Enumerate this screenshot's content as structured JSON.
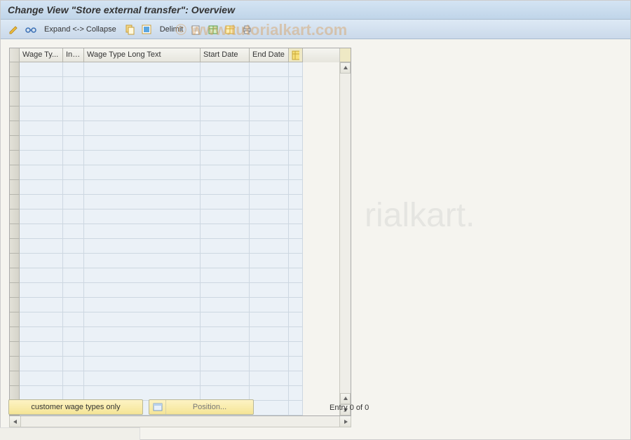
{
  "title": "Change View \"Store external transfer\": Overview",
  "toolbar": {
    "expand_collapse": "Expand <-> Collapse",
    "delimit": "Delimit"
  },
  "columns": {
    "wage_type": "Wage Ty...",
    "inf": "Inf...",
    "wage_type_long": "Wage Type Long Text",
    "start_date": "Start Date",
    "end_date": "End Date"
  },
  "row_count": 24,
  "footer": {
    "customer_btn": "customer wage types only",
    "position_btn": "Position...",
    "entry_text": "Entry 0 of 0"
  },
  "watermark1": "© www.tutorialkart.com",
  "watermark2": "rialkart."
}
